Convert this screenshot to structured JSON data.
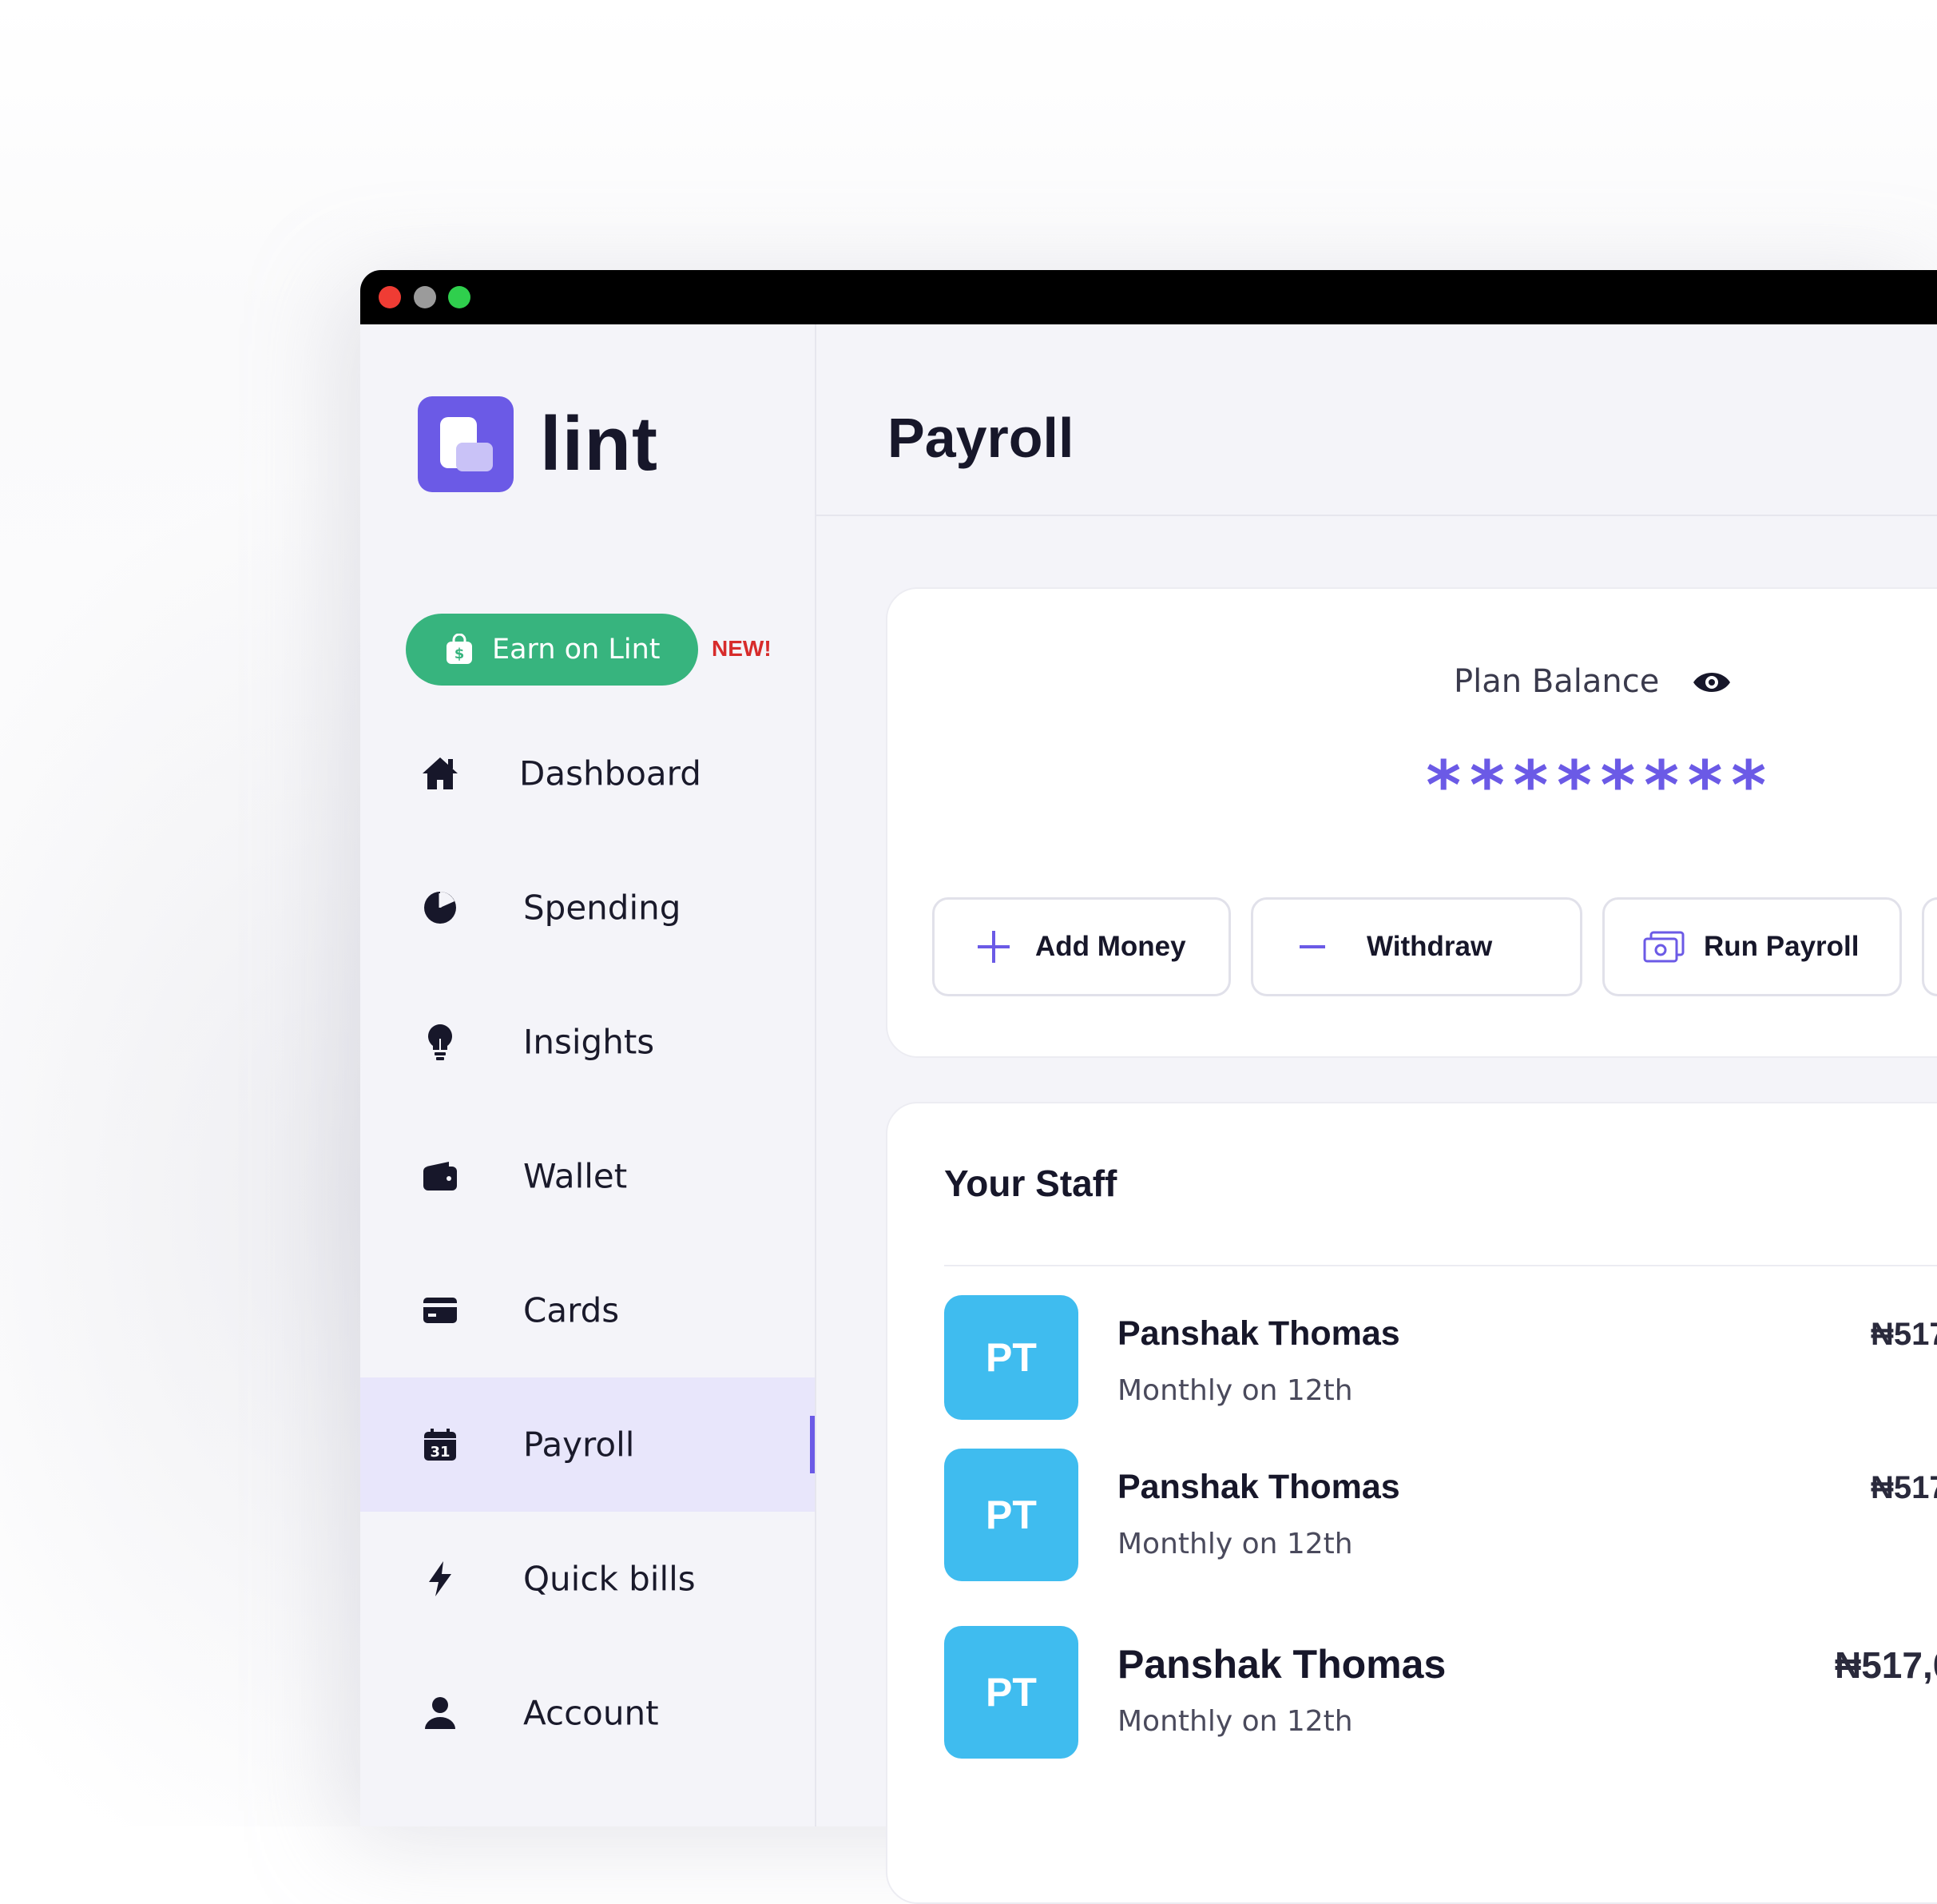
{
  "app": {
    "logo_text": "lint",
    "page_title": "Payroll"
  },
  "sidebar": {
    "earn": {
      "label": "Earn on Lint",
      "badge": "NEW!"
    },
    "items": [
      {
        "label": "Dashboard",
        "icon": "home-icon"
      },
      {
        "label": "Spending",
        "icon": "pie-chart-icon"
      },
      {
        "label": "Insights",
        "icon": "lightbulb-icon"
      },
      {
        "label": "Wallet",
        "icon": "wallet-icon"
      },
      {
        "label": "Cards",
        "icon": "card-icon"
      },
      {
        "label": "Payroll",
        "icon": "calendar-icon",
        "active": true
      },
      {
        "label": "Quick bills",
        "icon": "lightning-icon"
      },
      {
        "label": "Account",
        "icon": "user-icon"
      }
    ]
  },
  "balance": {
    "label": "Plan Balance",
    "masked_value": "********",
    "actions": {
      "add_money": "Add Money",
      "withdraw": "Withdraw",
      "run_payroll": "Run Payroll"
    }
  },
  "staff": {
    "title": "Your Staff",
    "rows": [
      {
        "initials": "PT",
        "name": "Panshak Thomas",
        "schedule": "Monthly on 12th",
        "amount": "₦517"
      },
      {
        "initials": "PT",
        "name": "Panshak Thomas",
        "schedule": "Monthly on 12th",
        "amount": "₦517"
      },
      {
        "initials": "PT",
        "name": "Panshak Thomas",
        "schedule": "Monthly on 12th",
        "amount": "₦517,0"
      }
    ]
  },
  "colors": {
    "brand": "#6b5ae6",
    "earn_green": "#37b47e",
    "new_badge": "#d72b2b",
    "avatar_blue": "#3fbcef",
    "active_nav_bg": "#e8e6fb"
  }
}
